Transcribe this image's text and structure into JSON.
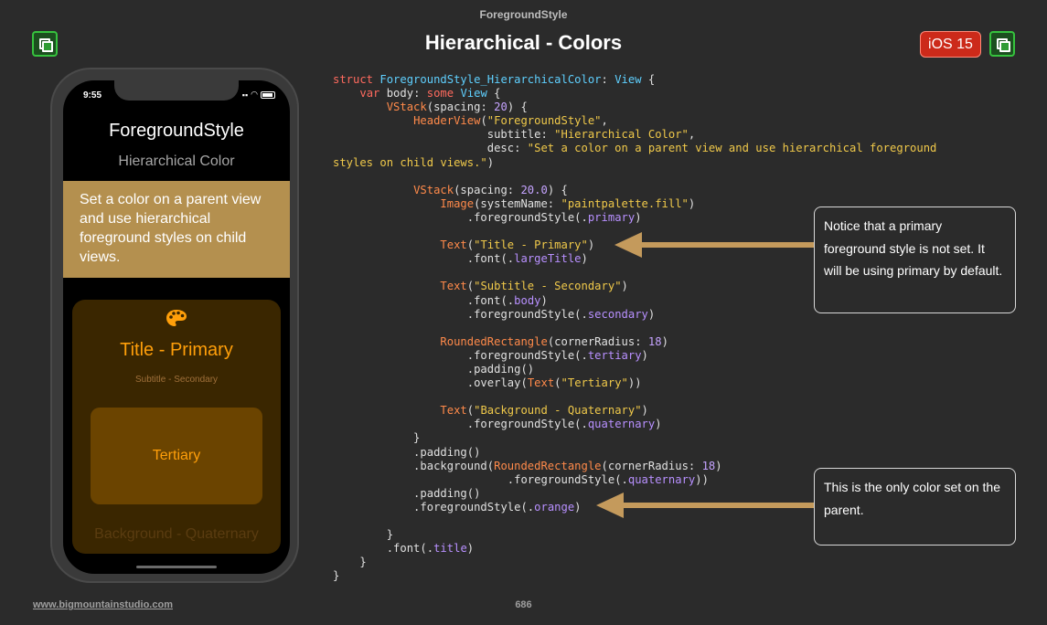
{
  "header": {
    "top_title": "ForegroundStyle",
    "main_title": "Hierarchical - Colors",
    "ios_badge": "iOS 15"
  },
  "phone": {
    "status_time": "9:55",
    "title": "ForegroundStyle",
    "subtitle": "Hierarchical Color",
    "desc": "Set a color on a parent view and use hierarchical foreground styles on child views.",
    "content": {
      "title": "Title - Primary",
      "subtitle": "Subtitle - Secondary",
      "tertiary": "Tertiary",
      "background": "Background - Quaternary"
    }
  },
  "code": {
    "lines": [
      [
        [
          "kw",
          "struct "
        ],
        [
          "ty",
          "ForegroundStyle_HierarchicalColor"
        ],
        [
          "",
          ": "
        ],
        [
          "ty",
          "View"
        ],
        [
          "",
          " {"
        ]
      ],
      [
        [
          "",
          "    "
        ],
        [
          "kw",
          "var "
        ],
        [
          "",
          "body: "
        ],
        [
          "kw",
          "some "
        ],
        [
          "ty",
          "View"
        ],
        [
          "",
          " {"
        ]
      ],
      [
        [
          "",
          "        "
        ],
        [
          "cl",
          "VStack"
        ],
        [
          "",
          "("
        ],
        [
          "",
          "spacing: "
        ],
        [
          "num",
          "20"
        ],
        [
          "",
          ") {"
        ]
      ],
      [
        [
          "",
          "            "
        ],
        [
          "cl",
          "HeaderView"
        ],
        [
          "",
          "("
        ],
        [
          "str",
          "\"ForegroundStyle\""
        ],
        [
          "",
          ","
        ]
      ],
      [
        [
          "",
          "                       subtitle: "
        ],
        [
          "str",
          "\"Hierarchical Color\""
        ],
        [
          "",
          ","
        ]
      ],
      [
        [
          "",
          "                       desc: "
        ],
        [
          "str",
          "\"Set a color on a parent view and use hierarchical foreground"
        ]
      ],
      [
        [
          "str",
          "styles on child views.\""
        ],
        [
          "",
          ")"
        ]
      ],
      [
        [
          "",
          ""
        ]
      ],
      [
        [
          "",
          "            "
        ],
        [
          "cl",
          "VStack"
        ],
        [
          "",
          "(spacing: "
        ],
        [
          "num",
          "20.0"
        ],
        [
          "",
          ") {"
        ]
      ],
      [
        [
          "",
          "                "
        ],
        [
          "cl",
          "Image"
        ],
        [
          "",
          "(systemName: "
        ],
        [
          "str",
          "\"paintpalette.fill\""
        ],
        [
          "",
          ")"
        ]
      ],
      [
        [
          "",
          "                    ."
        ],
        [
          "",
          "foregroundStyle"
        ],
        [
          "",
          "(."
        ],
        [
          "mem",
          "primary"
        ],
        [
          "",
          ")"
        ]
      ],
      [
        [
          "",
          ""
        ]
      ],
      [
        [
          "",
          "                "
        ],
        [
          "cl",
          "Text"
        ],
        [
          "",
          "("
        ],
        [
          "str",
          "\"Title - Primary\""
        ],
        [
          "",
          ")"
        ]
      ],
      [
        [
          "",
          "                    ."
        ],
        [
          "",
          "font"
        ],
        [
          "",
          "(."
        ],
        [
          "mem",
          "largeTitle"
        ],
        [
          "",
          ")"
        ]
      ],
      [
        [
          "",
          ""
        ]
      ],
      [
        [
          "",
          "                "
        ],
        [
          "cl",
          "Text"
        ],
        [
          "",
          "("
        ],
        [
          "str",
          "\"Subtitle - Secondary\""
        ],
        [
          "",
          ")"
        ]
      ],
      [
        [
          "",
          "                    ."
        ],
        [
          "",
          "font"
        ],
        [
          "",
          "(."
        ],
        [
          "mem",
          "body"
        ],
        [
          "",
          ")"
        ]
      ],
      [
        [
          "",
          "                    ."
        ],
        [
          "",
          "foregroundStyle"
        ],
        [
          "",
          "(."
        ],
        [
          "mem",
          "secondary"
        ],
        [
          "",
          ")"
        ]
      ],
      [
        [
          "",
          ""
        ]
      ],
      [
        [
          "",
          "                "
        ],
        [
          "cl",
          "RoundedRectangle"
        ],
        [
          "",
          "(cornerRadius: "
        ],
        [
          "num",
          "18"
        ],
        [
          "",
          ")"
        ]
      ],
      [
        [
          "",
          "                    ."
        ],
        [
          "",
          "foregroundStyle"
        ],
        [
          "",
          "(."
        ],
        [
          "mem",
          "tertiary"
        ],
        [
          "",
          ")"
        ]
      ],
      [
        [
          "",
          "                    ."
        ],
        [
          "",
          "padding"
        ],
        [
          "",
          "()"
        ]
      ],
      [
        [
          "",
          "                    ."
        ],
        [
          "",
          "overlay"
        ],
        [
          "",
          "("
        ],
        [
          "cl",
          "Text"
        ],
        [
          "",
          "("
        ],
        [
          "str",
          "\"Tertiary\""
        ],
        [
          "",
          "))"
        ]
      ],
      [
        [
          "",
          ""
        ]
      ],
      [
        [
          "",
          "                "
        ],
        [
          "cl",
          "Text"
        ],
        [
          "",
          "("
        ],
        [
          "str",
          "\"Background - Quaternary\""
        ],
        [
          "",
          ")"
        ]
      ],
      [
        [
          "",
          "                    ."
        ],
        [
          "",
          "foregroundStyle"
        ],
        [
          "",
          "(."
        ],
        [
          "mem",
          "quaternary"
        ],
        [
          "",
          ")"
        ]
      ],
      [
        [
          "",
          "            }"
        ]
      ],
      [
        [
          "",
          "            ."
        ],
        [
          "",
          "padding"
        ],
        [
          "",
          "()"
        ]
      ],
      [
        [
          "",
          "            ."
        ],
        [
          "",
          "background"
        ],
        [
          "",
          "("
        ],
        [
          "cl",
          "RoundedRectangle"
        ],
        [
          "",
          "(cornerRadius: "
        ],
        [
          "num",
          "18"
        ],
        [
          "",
          ")"
        ]
      ],
      [
        [
          "",
          "                          ."
        ],
        [
          "",
          "foregroundStyle"
        ],
        [
          "",
          "(."
        ],
        [
          "mem",
          "quaternary"
        ],
        [
          "",
          "))"
        ]
      ],
      [
        [
          "",
          "            ."
        ],
        [
          "",
          "padding"
        ],
        [
          "",
          "()"
        ]
      ],
      [
        [
          "",
          "            ."
        ],
        [
          "",
          "foregroundStyle"
        ],
        [
          "",
          "(."
        ],
        [
          "mem",
          "orange"
        ],
        [
          "",
          ")"
        ]
      ],
      [
        [
          "",
          ""
        ]
      ],
      [
        [
          "",
          "        }"
        ]
      ],
      [
        [
          "",
          "        ."
        ],
        [
          "",
          "font"
        ],
        [
          "",
          "(."
        ],
        [
          "mem",
          "title"
        ],
        [
          "",
          ")"
        ]
      ],
      [
        [
          "",
          "    }"
        ]
      ],
      [
        [
          "",
          "}"
        ]
      ]
    ]
  },
  "callouts": {
    "first": "Notice that a primary foreground style is not set. It will be using primary by default.",
    "second": "This is the only color set on the parent."
  },
  "footer": {
    "link": "www.bigmountainstudio.com",
    "page": "686"
  },
  "colors": {
    "background": "#2b2b2b",
    "orange": "#ff9f0a",
    "desc_bg": "#b4904f",
    "arrow": "#c49a5c",
    "badge_red": "#cc2a1a",
    "icon_green": "#36c23e"
  }
}
